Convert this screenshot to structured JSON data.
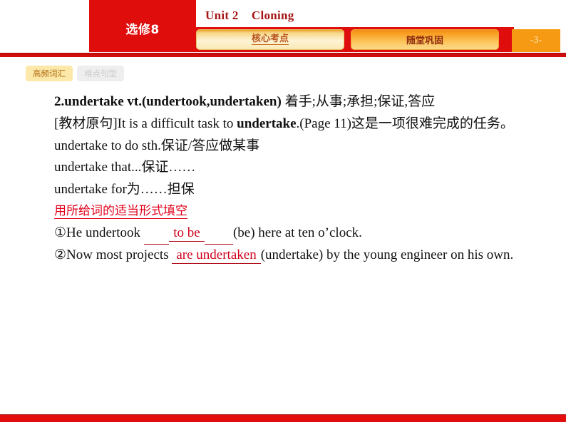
{
  "header": {
    "volume_label": "选修8",
    "unit_title": "Unit 2    Cloning",
    "page_number": "-3-",
    "tabs": [
      {
        "label": "核心考点",
        "state": "active"
      },
      {
        "label": "随堂巩固",
        "state": "inactive"
      }
    ]
  },
  "subtabs": [
    {
      "label": "高频词汇",
      "state": "active"
    },
    {
      "label": "难点句型",
      "state": "inactive"
    }
  ],
  "content": {
    "entry": {
      "number_word": "2.undertake vt.(undertook,undertaken)",
      "gloss": " 着手;从事;承担;保证,答应"
    },
    "textbook_quote": {
      "tag": "[教材原句]",
      "before": "It is a difficult task to ",
      "keyword": "undertake",
      "after": ".(Page 11)这是一项很难完成的任务。"
    },
    "usages": [
      "undertake to do sth.保证/答应做某事",
      "undertake that...保证……",
      "undertake for为……担保"
    ],
    "exercise_heading": "用所给词的适当形式填空",
    "exercises": [
      {
        "marker": "①",
        "before": "He undertook ",
        "answer": "to be",
        "after": "(be) here at ten o’clock."
      },
      {
        "marker": "②",
        "before": "Now most projects ",
        "answer": "are undertaken",
        "after": "(undertake) by the young engineer on his own."
      }
    ]
  },
  "colors": {
    "brand_red": "#e00d0d",
    "title_red": "#a61616",
    "answer_red": "#d0021b",
    "heading_red": "#e1001a",
    "badge_orange": "#f59a12",
    "active_subtab": "#fce8a8"
  }
}
